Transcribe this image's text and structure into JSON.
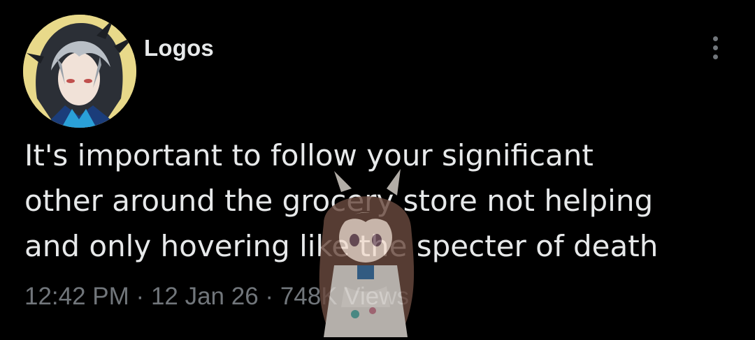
{
  "author": {
    "display_name": "Logos"
  },
  "tweet": {
    "text_lines": [
      "It's important to follow your significant",
      "other around the grocery store not helping",
      "and only hovering like the specter of death"
    ],
    "time": "12:42 PM",
    "separator": "·",
    "date": "12 Jan 26",
    "views_count": "748K",
    "views_label": "Views"
  },
  "icons": {
    "more": "more-options-icon",
    "avatar": "avatar-image",
    "sticker": "anime-girl-sticker"
  },
  "colors": {
    "background": "#000000",
    "primary_text": "#e7e9ea",
    "secondary_text": "#71767b",
    "avatar_bg": "#e8d98a"
  }
}
